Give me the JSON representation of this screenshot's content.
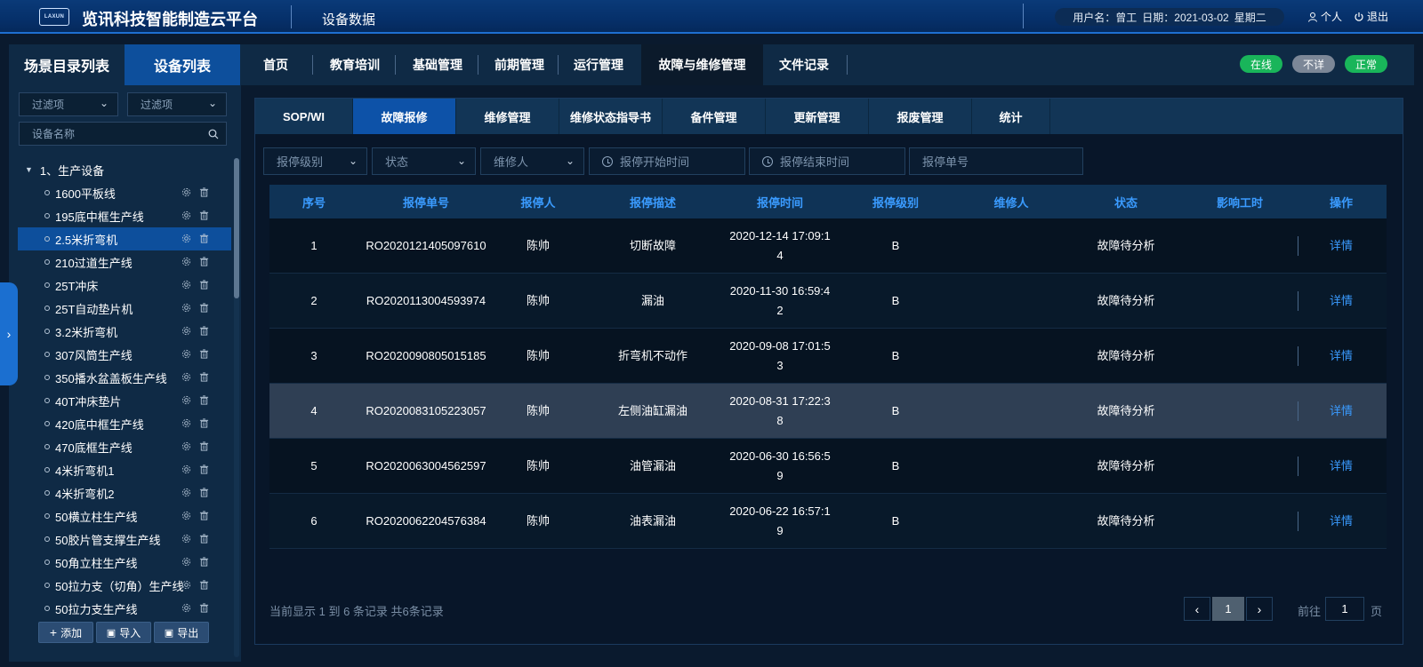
{
  "header": {
    "logo_text": "LAXUN",
    "app_title": "览讯科技智能制造云平台",
    "page_title": "设备数据",
    "user_label": "用户名：曾工",
    "date_label": "日期：2021-03-02",
    "weekday": "星期二",
    "personal_label": "个人",
    "logout_label": "退出"
  },
  "left_panel": {
    "tabs": [
      "场景目录列表",
      "设备列表"
    ],
    "filter1_placeholder": "过滤项",
    "filter2_placeholder": "过滤项",
    "search_placeholder": "设备名称",
    "tree_root": "1、生产设备",
    "tree_items": [
      "1600平板线",
      "195底中框生产线",
      "2.5米折弯机",
      "210过道生产线",
      "25T冲床",
      "25T自动垫片机",
      "3.2米折弯机",
      "307风筒生产线",
      "350播水盆盖板生产线",
      "40T冲床垫片",
      "420底中框生产线",
      "470底框生产线",
      "4米折弯机1",
      "4米折弯机2",
      "50横立柱生产线",
      "50胶片管支撑生产线",
      "50角立柱生产线",
      "50拉力支（切角）生产线",
      "50拉力支生产线"
    ],
    "active_item_index": 2,
    "buttons": {
      "add": "添加",
      "import": "导入",
      "export": "导出"
    }
  },
  "main_nav": {
    "items": [
      "首页",
      "教育培训",
      "基础管理",
      "前期管理",
      "运行管理",
      "故障与维修管理",
      "文件记录"
    ],
    "active_index": 5,
    "status_pills": [
      {
        "label": "在线",
        "color": "#19b55a"
      },
      {
        "label": "不详",
        "color": "#7c8797"
      },
      {
        "label": "正常",
        "color": "#19b55a"
      }
    ]
  },
  "sub_tabs": {
    "items": [
      "SOP/WI",
      "故障报修",
      "维修管理",
      "维修状态指导书",
      "备件管理",
      "更新管理",
      "报废管理",
      "统计"
    ],
    "active_index": 1
  },
  "filters": {
    "level": "报停级别",
    "status": "状态",
    "repairer": "维修人",
    "start_time": "报停开始时间",
    "end_time": "报停结束时间",
    "order_no": "报停单号"
  },
  "table": {
    "columns": [
      "序号",
      "报停单号",
      "报停人",
      "报停描述",
      "报停时间",
      "报停级别",
      "维修人",
      "状态",
      "影响工时",
      "操作"
    ],
    "rows": [
      {
        "no": "1",
        "order": "RO2020121405097610",
        "reporter": "陈帅",
        "desc": "切断故障",
        "time": "2020-12-14 17:09:14",
        "level": "B",
        "repairer": "",
        "status": "故障待分析",
        "hours": "",
        "action": "详情"
      },
      {
        "no": "2",
        "order": "RO2020113004593974",
        "reporter": "陈帅",
        "desc": "漏油",
        "time": "2020-11-30 16:59:42",
        "level": "B",
        "repairer": "",
        "status": "故障待分析",
        "hours": "",
        "action": "详情"
      },
      {
        "no": "3",
        "order": "RO2020090805015185",
        "reporter": "陈帅",
        "desc": "折弯机不动作",
        "time": "2020-09-08 17:01:53",
        "level": "B",
        "repairer": "",
        "status": "故障待分析",
        "hours": "",
        "action": "详情"
      },
      {
        "no": "4",
        "order": "RO2020083105223057",
        "reporter": "陈帅",
        "desc": "左侧油缸漏油",
        "time": "2020-08-31 17:22:38",
        "level": "B",
        "repairer": "",
        "status": "故障待分析",
        "hours": "",
        "action": "详情"
      },
      {
        "no": "5",
        "order": "RO2020063004562597",
        "reporter": "陈帅",
        "desc": "油管漏油",
        "time": "2020-06-30 16:56:59",
        "level": "B",
        "repairer": "",
        "status": "故障待分析",
        "hours": "",
        "action": "详情"
      },
      {
        "no": "6",
        "order": "RO2020062204576384",
        "reporter": "陈帅",
        "desc": "油表漏油",
        "time": "2020-06-22 16:57:19",
        "level": "B",
        "repairer": "",
        "status": "故障待分析",
        "hours": "",
        "action": "详情"
      }
    ],
    "highlight_row_index": 3
  },
  "pagination": {
    "summary": "当前显示 1 到 6 条记录 共6条记录",
    "current_page": "1",
    "goto_label": "前往",
    "goto_value": "1",
    "page_suffix": "页"
  }
}
